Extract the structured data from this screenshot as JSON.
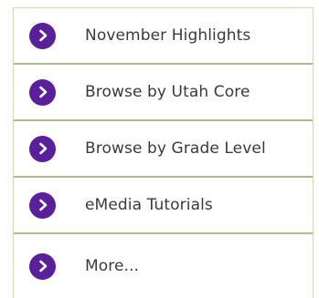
{
  "menu": {
    "items": [
      {
        "label": "November Highlights",
        "icon": "chevron-right-circle-icon"
      },
      {
        "label": "Browse by Utah Core",
        "icon": "chevron-right-circle-icon"
      },
      {
        "label": "Browse by Grade Level",
        "icon": "chevron-right-circle-icon"
      },
      {
        "label": "eMedia Tutorials",
        "icon": "chevron-right-circle-icon"
      },
      {
        "label": "More...",
        "icon": "chevron-right-circle-icon"
      }
    ]
  },
  "colors": {
    "icon_background": "#5a1f9a",
    "divider": "#a8c08c",
    "text": "#3a3a3a"
  }
}
